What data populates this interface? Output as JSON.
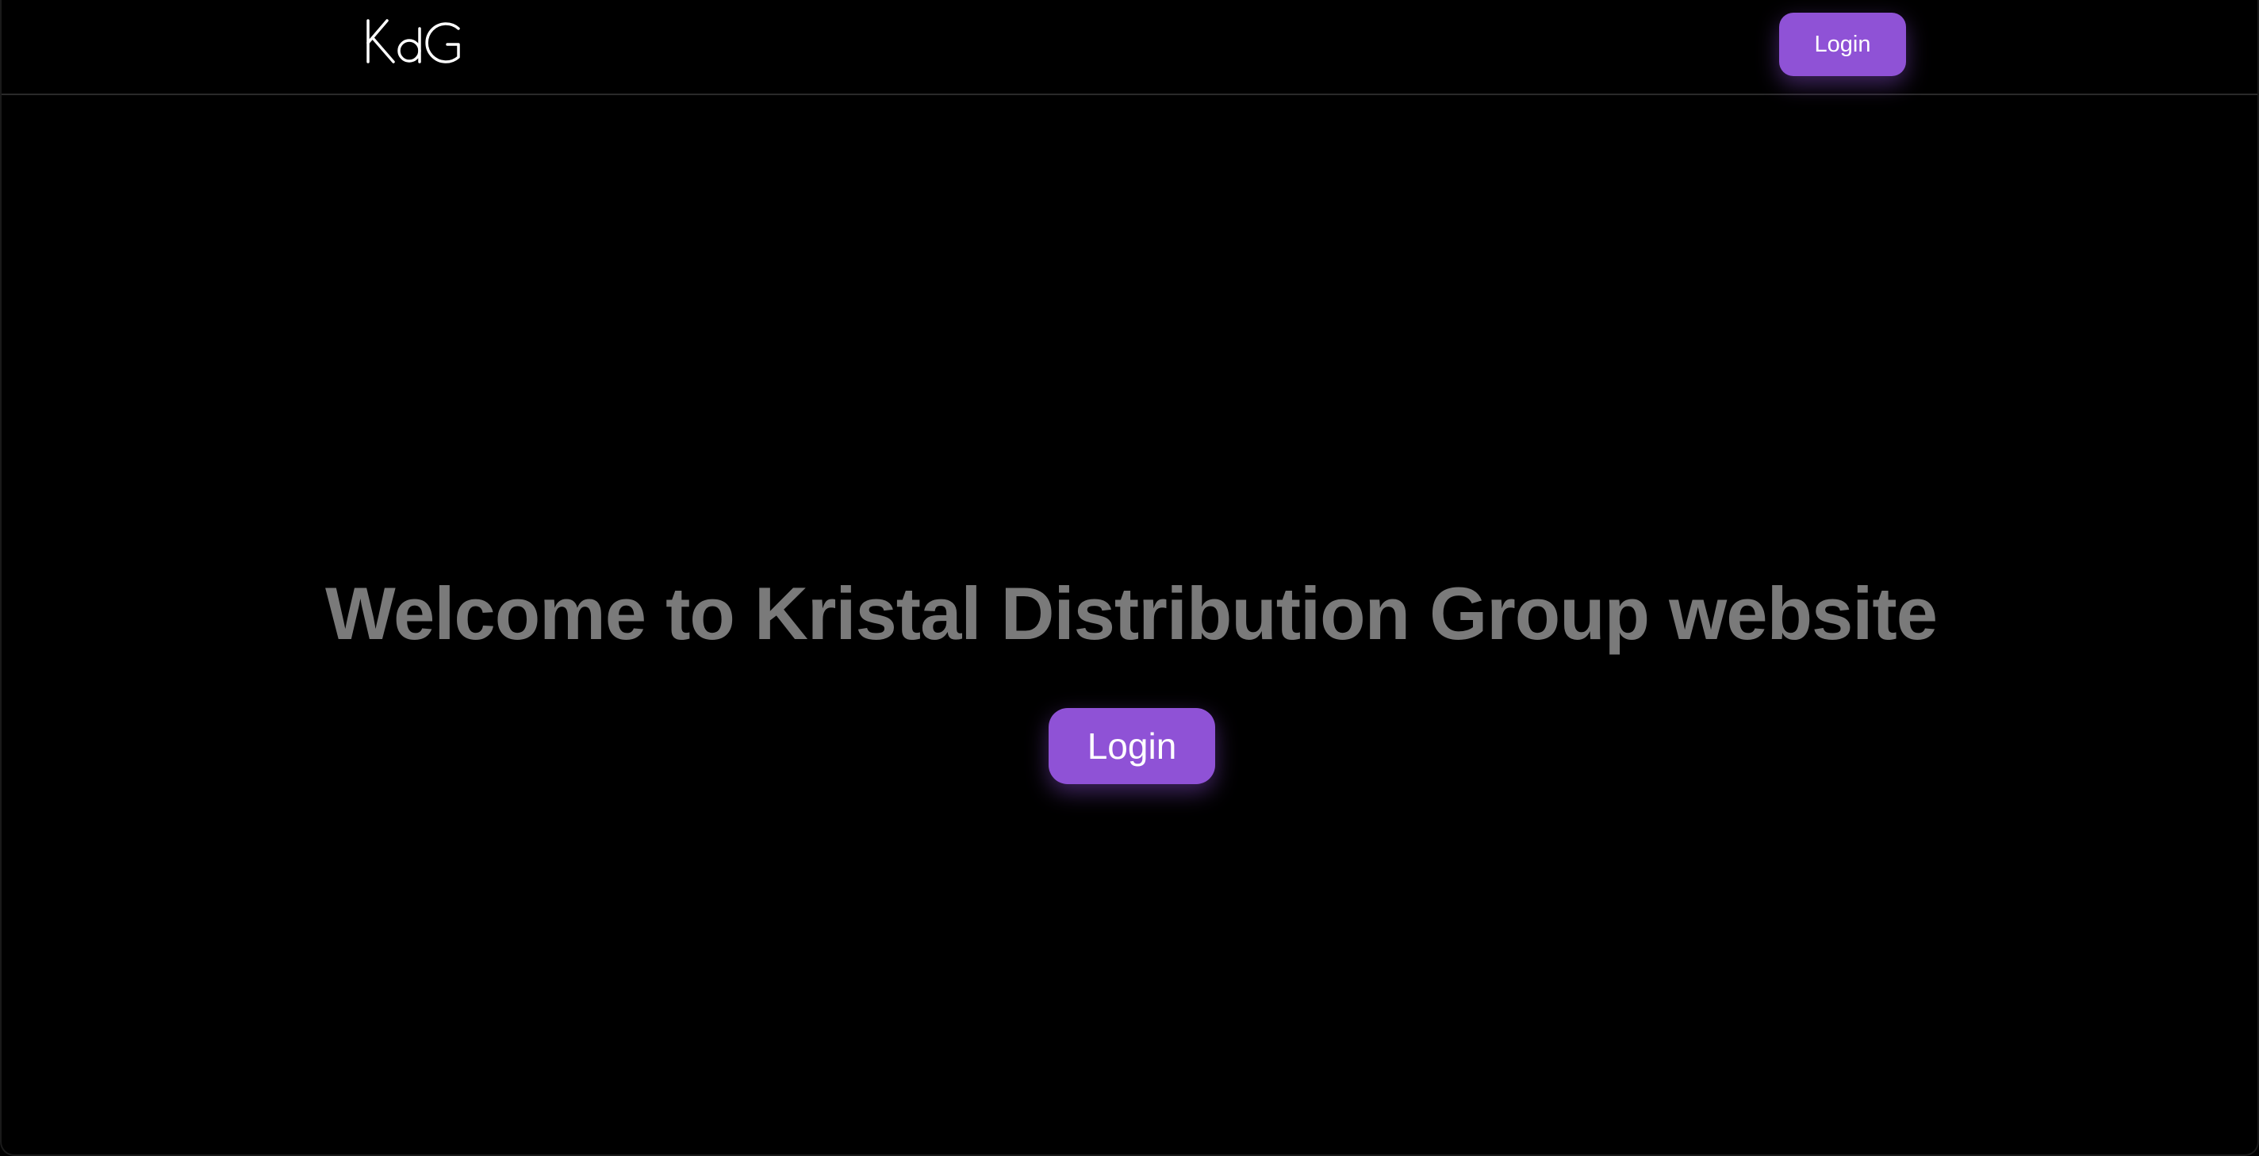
{
  "header": {
    "logo_text": "KdG",
    "login_label": "Login"
  },
  "hero": {
    "title": "Welcome to Kristal Distribution Group website",
    "login_label": "Login"
  },
  "colors": {
    "background": "#000000",
    "accent": "#8f52d6",
    "title_text": "#7a7a7a",
    "button_text": "#ffffff"
  }
}
